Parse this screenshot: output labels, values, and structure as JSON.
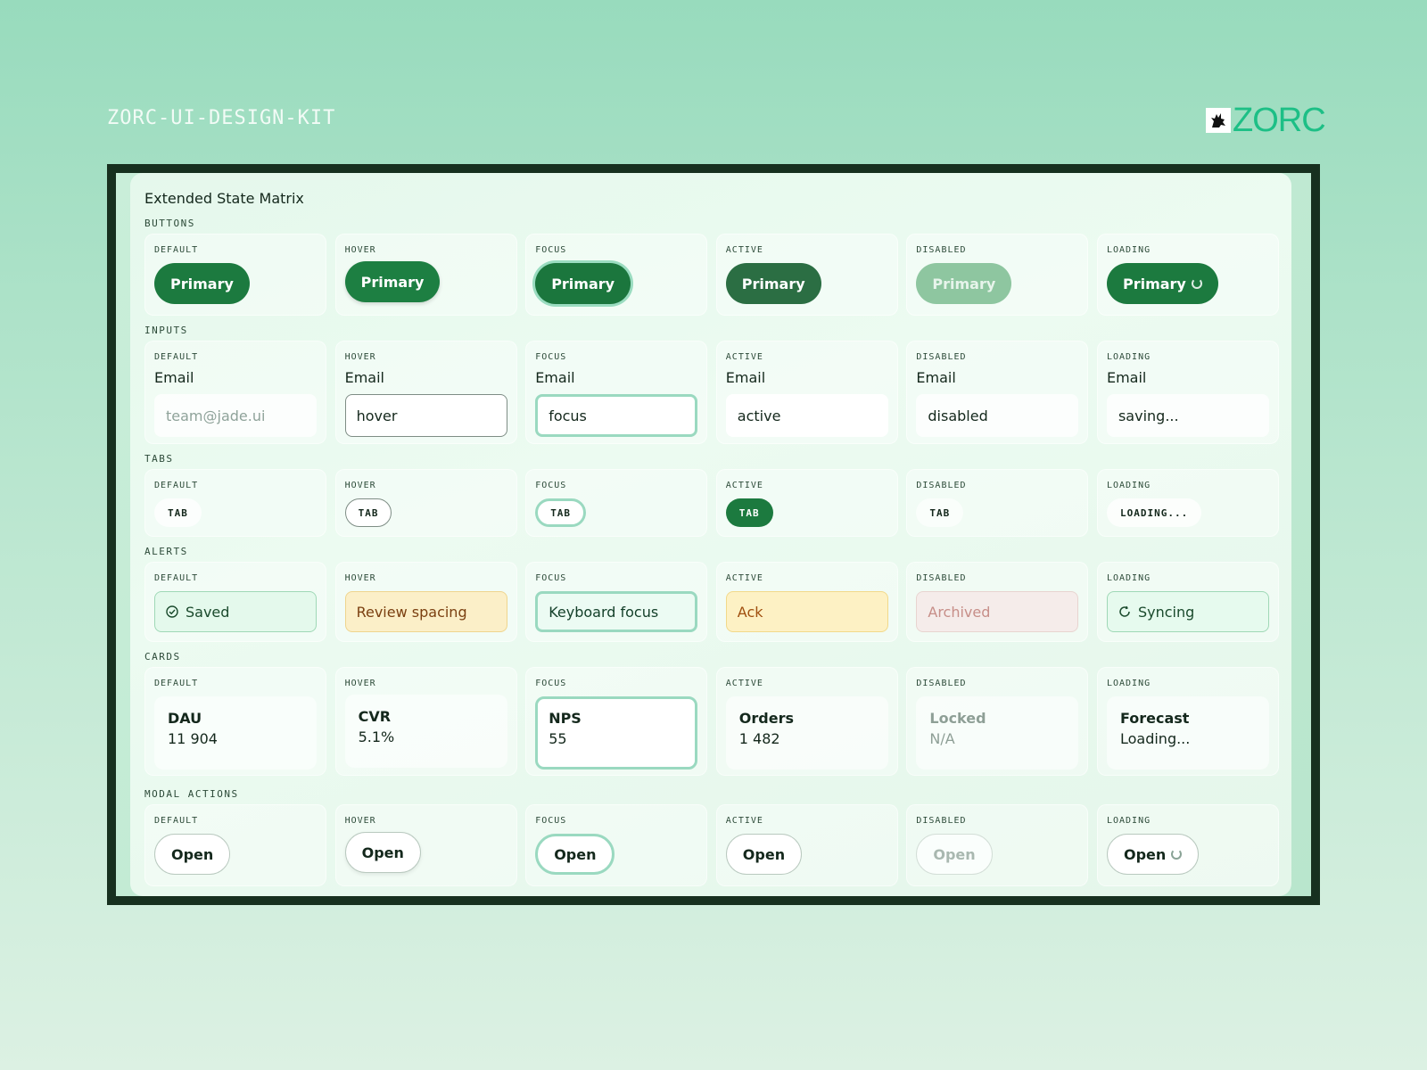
{
  "header": {
    "kit_title": "ZORC-UI-DESIGN-KIT",
    "brand_name": "ZORC",
    "brand_color": "#1dbf86"
  },
  "panel": {
    "title": "Extended State Matrix"
  },
  "states": [
    "DEFAULT",
    "HOVER",
    "FOCUS",
    "ACTIVE",
    "DISABLED",
    "LOADING"
  ],
  "buttons": {
    "section": "BUTTONS",
    "label": "Primary",
    "accent": "#1c7a3f"
  },
  "inputs": {
    "section": "INPUTS",
    "field_label": "Email",
    "placeholder": "team@jade.ui",
    "values": [
      "",
      "hover",
      "focus",
      "active",
      "disabled",
      "saving..."
    ]
  },
  "tabs": {
    "section": "TABS",
    "labels": [
      "TAB",
      "TAB",
      "TAB",
      "TAB",
      "TAB",
      "LOADING..."
    ]
  },
  "alerts": {
    "section": "ALERTS",
    "labels": [
      "Saved",
      "Review spacing",
      "Keyboard focus",
      "Ack",
      "Archived",
      "Syncing"
    ]
  },
  "cards": {
    "section": "CARDS",
    "items": [
      {
        "title": "DAU",
        "value": "11 904"
      },
      {
        "title": "CVR",
        "value": "5.1%"
      },
      {
        "title": "NPS",
        "value": "55"
      },
      {
        "title": "Orders",
        "value": "1 482"
      },
      {
        "title": "Locked",
        "value": "N/A"
      },
      {
        "title": "Forecast",
        "value": "Loading..."
      }
    ]
  },
  "modal_actions": {
    "section": "MODAL ACTIONS",
    "label": "Open"
  }
}
